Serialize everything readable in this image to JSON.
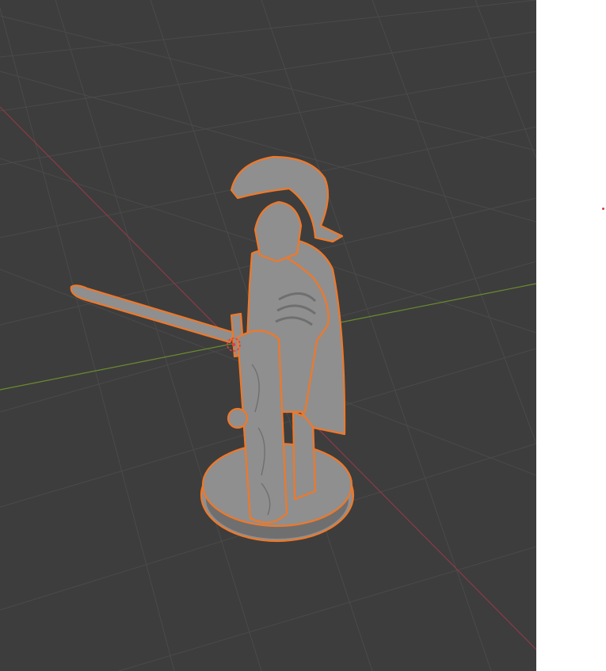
{
  "viewport": {
    "background_color": "#3d3d3d",
    "grid_color": "#4a4a4a",
    "x_axis_color": "#8a3b49",
    "y_axis_color": "#6a8c2e",
    "object_name": "roman-legionary-statue",
    "object_color": "#8f8f8f",
    "object_shadow_color": "#6f6f6f",
    "selection_outline_color": "#f07828",
    "cursor_color": "#e04040"
  },
  "side_panel": {
    "background_color": "#ffffff",
    "indicator_color": "#d23c3c"
  }
}
